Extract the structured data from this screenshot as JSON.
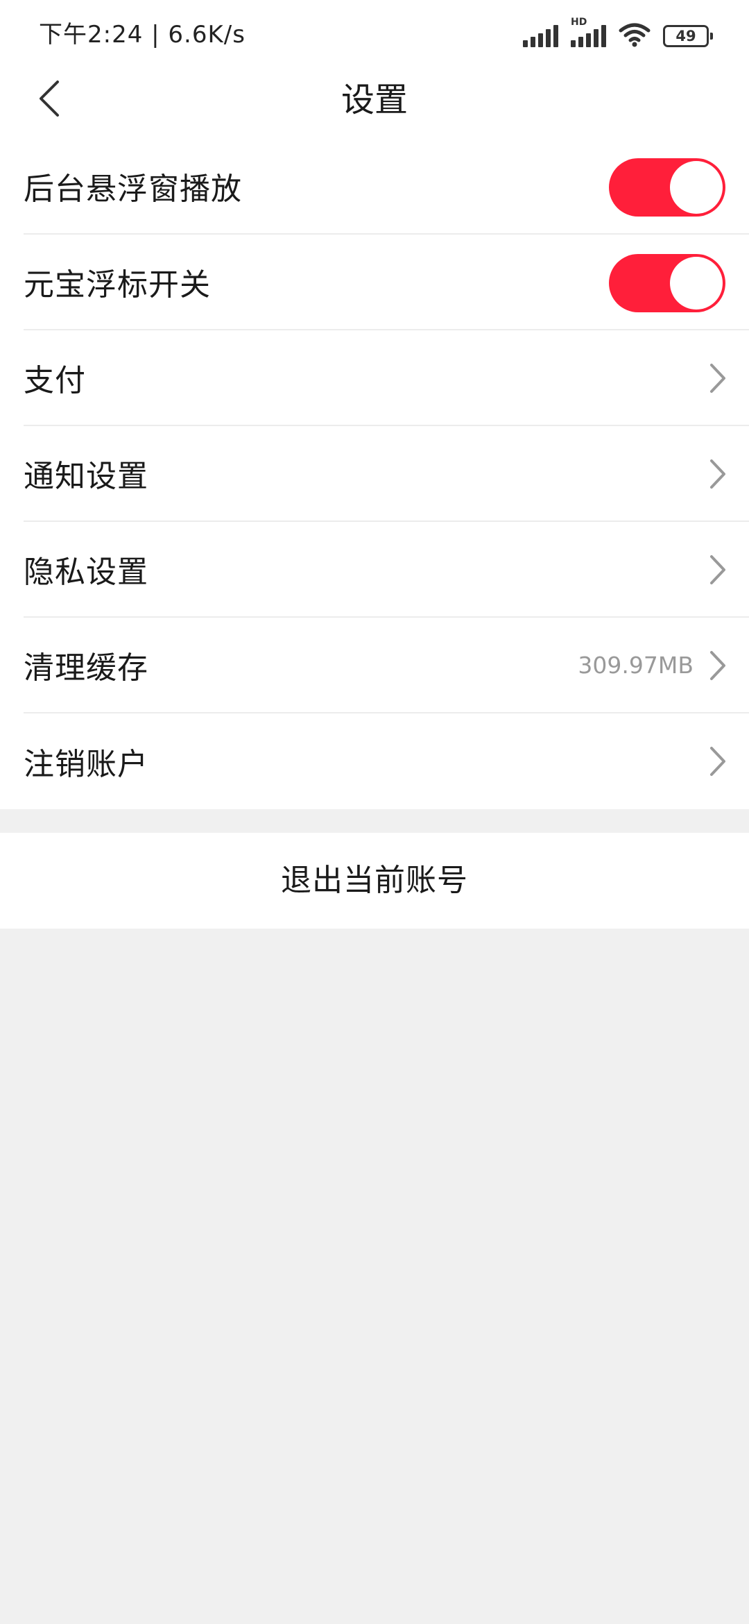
{
  "status_bar": {
    "time_speed": "下午2:24 | 6.6K/s",
    "hd_label": "HD",
    "battery": "49"
  },
  "header": {
    "title": "设置"
  },
  "settings": {
    "items": [
      {
        "label": "后台悬浮窗播放",
        "type": "toggle",
        "on": true
      },
      {
        "label": "元宝浮标开关",
        "type": "toggle",
        "on": true
      },
      {
        "label": "支付",
        "type": "link"
      },
      {
        "label": "通知设置",
        "type": "link"
      },
      {
        "label": "隐私设置",
        "type": "link"
      },
      {
        "label": "清理缓存",
        "type": "link",
        "value": "309.97MB"
      },
      {
        "label": "注销账户",
        "type": "link"
      }
    ]
  },
  "logout": {
    "label": "退出当前账号"
  },
  "colors": {
    "accent": "#ff1f3a",
    "background": "#f0f0f0",
    "chevron": "#999999"
  },
  "icons": {
    "back": "chevron-left-icon",
    "row_arrow": "chevron-right-icon",
    "signal": "signal-icon",
    "wifi": "wifi-icon",
    "battery": "battery-icon"
  }
}
